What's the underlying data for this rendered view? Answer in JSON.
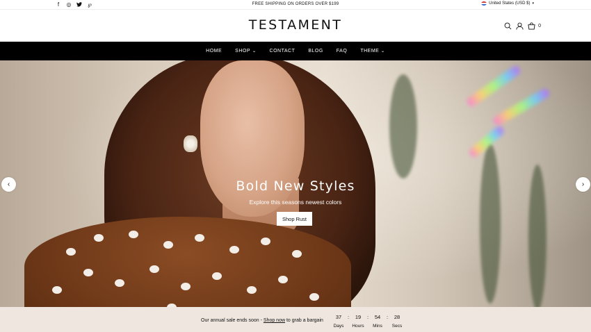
{
  "topbar": {
    "social": [
      {
        "icon": "facebook-icon",
        "glyph": "f"
      },
      {
        "icon": "instagram-icon",
        "glyph": "◎"
      },
      {
        "icon": "twitter-icon",
        "glyph": "🐦"
      },
      {
        "icon": "pinterest-icon",
        "glyph": "℘"
      }
    ],
    "announcement": "FREE SHIPPING ON ORDERS OVER $199",
    "currency": "United States (USD $)"
  },
  "header": {
    "logo": "TESTAMENT",
    "cart_count": "0"
  },
  "nav": {
    "items": [
      {
        "label": "HOME",
        "has_dropdown": false
      },
      {
        "label": "SHOP",
        "has_dropdown": true
      },
      {
        "label": "CONTACT",
        "has_dropdown": false
      },
      {
        "label": "BLOG",
        "has_dropdown": false
      },
      {
        "label": "FAQ",
        "has_dropdown": false
      },
      {
        "label": "THEME",
        "has_dropdown": true
      }
    ]
  },
  "hero": {
    "title": "Bold New Styles",
    "subtitle": "Explore this seasons newest colors",
    "cta": "Shop Rust",
    "prev_glyph": "‹",
    "next_glyph": "›"
  },
  "countdown": {
    "text_before": "Our annual sale ends soon - ",
    "link": "Shop now",
    "text_after": " to grab a bargain",
    "units": [
      {
        "value": "37",
        "label": "Days"
      },
      {
        "value": "19",
        "label": "Hours"
      },
      {
        "value": "54",
        "label": "Mins"
      },
      {
        "value": "28",
        "label": "Secs"
      }
    ],
    "separator": ":"
  },
  "colors": {
    "nav_bg": "#000000",
    "countdown_bg": "#efe6df",
    "blouse": "#6e3818"
  }
}
